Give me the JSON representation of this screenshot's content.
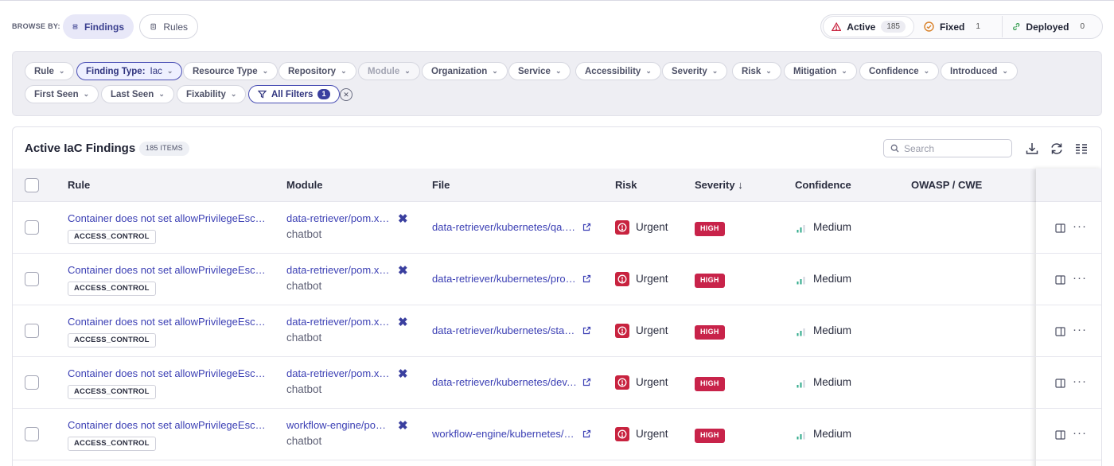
{
  "browse": {
    "label": "BROWSE BY:",
    "findings_label": "Findings",
    "rules_label": "Rules"
  },
  "status": {
    "active_label": "Active",
    "active_count": "185",
    "fixed_label": "Fixed",
    "fixed_count": "1",
    "deployed_label": "Deployed",
    "deployed_count": "0"
  },
  "filters": {
    "rule": "Rule",
    "finding_type_label": "Finding Type:",
    "finding_type_value": "Iac",
    "resource_type": "Resource Type",
    "repository": "Repository",
    "module": "Module",
    "organization": "Organization",
    "service": "Service",
    "accessibility": "Accessibility",
    "severity": "Severity",
    "risk": "Risk",
    "mitigation": "Mitigation",
    "confidence": "Confidence",
    "introduced": "Introduced",
    "first_seen": "First Seen",
    "last_seen": "Last Seen",
    "fixability": "Fixability",
    "all_filters": "All Filters",
    "all_filters_count": "1"
  },
  "table": {
    "title": "Active IaC Findings",
    "items_badge": "185 ITEMS",
    "search_placeholder": "Search",
    "columns": {
      "rule": "Rule",
      "module": "Module",
      "file": "File",
      "risk": "Risk",
      "severity": "Severity",
      "confidence": "Confidence",
      "owasp": "OWASP / CWE"
    },
    "rows": [
      {
        "rule": "Container does not set allowPrivilegeEscalation",
        "tag": "ACCESS_CONTROL",
        "module": "data-retriever/pom.xml",
        "service": "chatbot",
        "file": "data-retriever/kubernetes/qa.yaml",
        "risk": "Urgent",
        "severity": "HIGH",
        "confidence": "Medium"
      },
      {
        "rule": "Container does not set allowPrivilegeEscalation",
        "tag": "ACCESS_CONTROL",
        "module": "data-retriever/pom.xml",
        "service": "chatbot",
        "file": "data-retriever/kubernetes/prod.yaml",
        "risk": "Urgent",
        "severity": "HIGH",
        "confidence": "Medium"
      },
      {
        "rule": "Container does not set allowPrivilegeEscalation",
        "tag": "ACCESS_CONTROL",
        "module": "data-retriever/pom.xml",
        "service": "chatbot",
        "file": "data-retriever/kubernetes/staging.yaml",
        "risk": "Urgent",
        "severity": "HIGH",
        "confidence": "Medium"
      },
      {
        "rule": "Container does not set allowPrivilegeEscalation",
        "tag": "ACCESS_CONTROL",
        "module": "data-retriever/pom.xml",
        "service": "chatbot",
        "file": "data-retriever/kubernetes/dev.yaml",
        "risk": "Urgent",
        "severity": "HIGH",
        "confidence": "Medium"
      },
      {
        "rule": "Container does not set allowPrivilegeEscalation",
        "tag": "ACCESS_CONTROL",
        "module": "workflow-engine/pom.xml",
        "service": "chatbot",
        "file": "workflow-engine/kubernetes/qa.yaml",
        "risk": "Urgent",
        "severity": "HIGH",
        "confidence": "Medium"
      }
    ]
  },
  "colors": {
    "accent": "#3b3fb4",
    "urgent": "#c8233f",
    "high": "#c8234a",
    "confidence": "#2eaa8a"
  }
}
